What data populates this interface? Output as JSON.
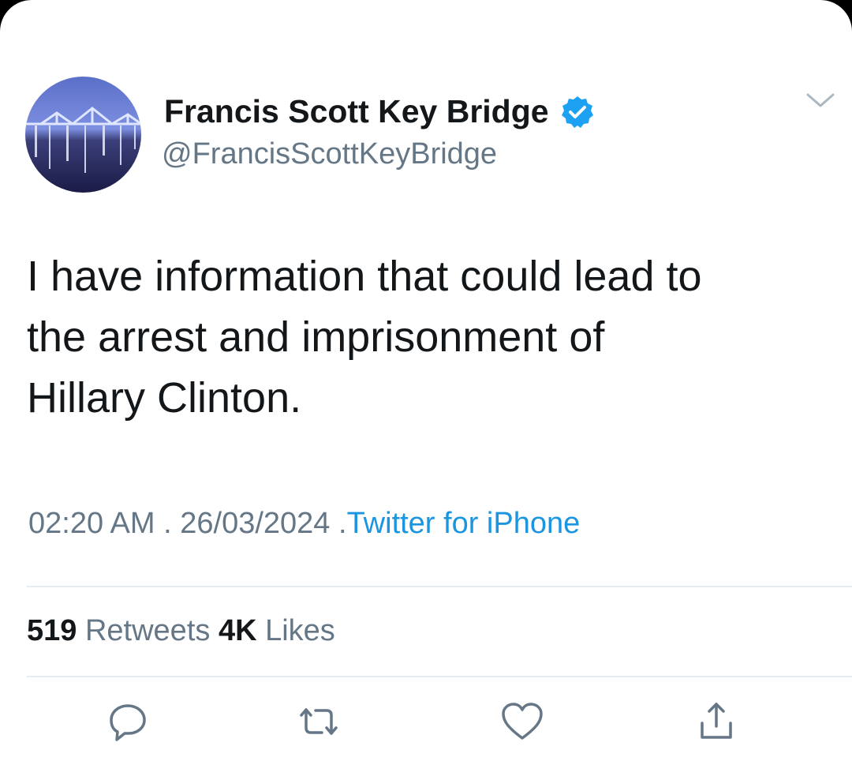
{
  "tweet": {
    "display_name": "Francis Scott Key Bridge",
    "handle": "@FrancisScottKeyBridge",
    "text_lines": [
      "I have information that could lead to",
      "the arrest and imprisonment of",
      "Hillary Clinton."
    ],
    "time": "02:20 AM",
    "separator": ".",
    "date": "26/03/2024",
    "source": "Twitter for iPhone",
    "retweets_count": "519",
    "retweets_label": "Retweets",
    "likes_count": "4K",
    "likes_label": "Likes"
  },
  "icons": {
    "verified": "verified-badge-icon",
    "menu": "chevron-down-icon",
    "reply": "reply-icon",
    "retweet": "retweet-icon",
    "like": "heart-icon",
    "share": "share-icon"
  },
  "colors": {
    "text": "#14171a",
    "secondary": "#657786",
    "link": "#1b95e0",
    "verified": "#1da1f2",
    "divider": "#e6ecf0"
  }
}
